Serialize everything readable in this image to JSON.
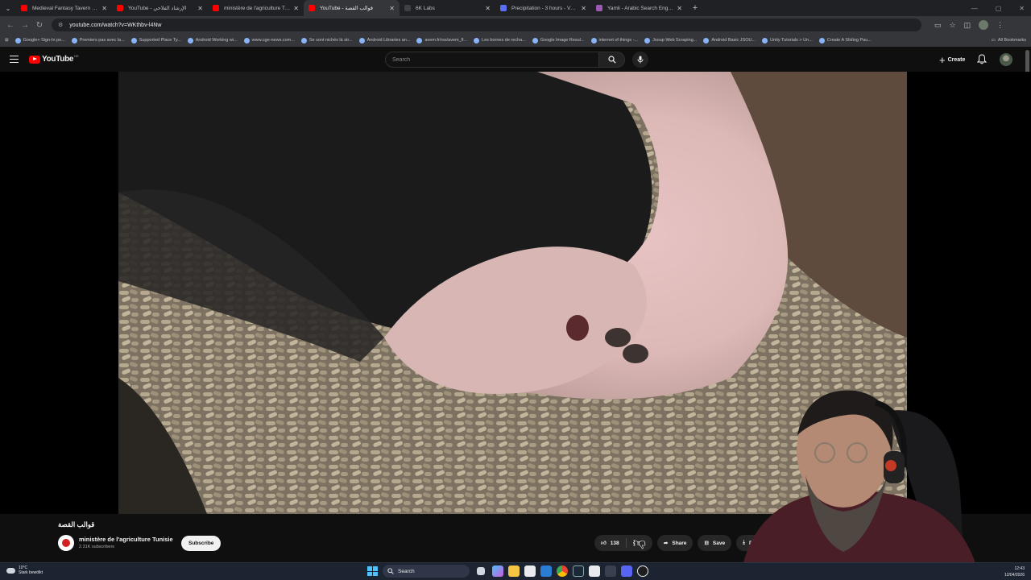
{
  "browser": {
    "tabs": [
      {
        "title": "Medieval Fantasy Tavern 3 | D&",
        "favicon_color": "#ff0000"
      },
      {
        "title": "YouTube - الإرشاد الفلاحي",
        "favicon_color": "#ff0000"
      },
      {
        "title": "ministère de l'agriculture Tunisi",
        "favicon_color": "#ff0000"
      },
      {
        "title": "YouTube - قوالب القصة",
        "favicon_color": "#ff0000",
        "active": true
      },
      {
        "title": "6K Labs",
        "favicon_color": "#3c4043"
      },
      {
        "title": "Precipitation - 3 hours - Ventu",
        "favicon_color": "#5b6ef5"
      },
      {
        "title": "Yamli - Arabic Search Engine a",
        "favicon_color": "#9b59b6"
      }
    ],
    "url": "youtube.com/watch?v=WKthbv-l4Nw",
    "bookmarks": [
      "Google+ Sign-In po...",
      "Premiers pas avec la...",
      "Supported Place Ty...",
      "Android Working wi...",
      "www.cge-news.com...",
      "Se sont nichés là str...",
      "Android Libraries an...",
      "avem.fr/rss/avem_fl...",
      "Les bornes de recha...",
      "Google Image Resul...",
      "internet of things -...",
      "Jsoup Web Scraping...",
      "Android Basic JSOU...",
      "Unity Tutorials > Un...",
      "Create A Sliding Pau..."
    ],
    "all_bookmarks_label": "All Bookmarks"
  },
  "youtube": {
    "logo_text": "YouTube",
    "country_code": "DE",
    "search_placeholder": "Search",
    "create_label": "Create",
    "video": {
      "title": "قوالب القصة",
      "channel_name": "ministère de l'agriculture Tunisie",
      "subscribers": "2.31K subscribers",
      "subscribe_label": "Subscribe",
      "likes": "138",
      "share_label": "Share",
      "save_label": "Save",
      "download_label": "Do"
    }
  },
  "taskbar": {
    "temperature": "10°C",
    "weather_desc": "Stark bewölkt",
    "search_label": "Search",
    "time": "12:43",
    "date": "12/04/2026",
    "accent": "#4cc2ff"
  }
}
